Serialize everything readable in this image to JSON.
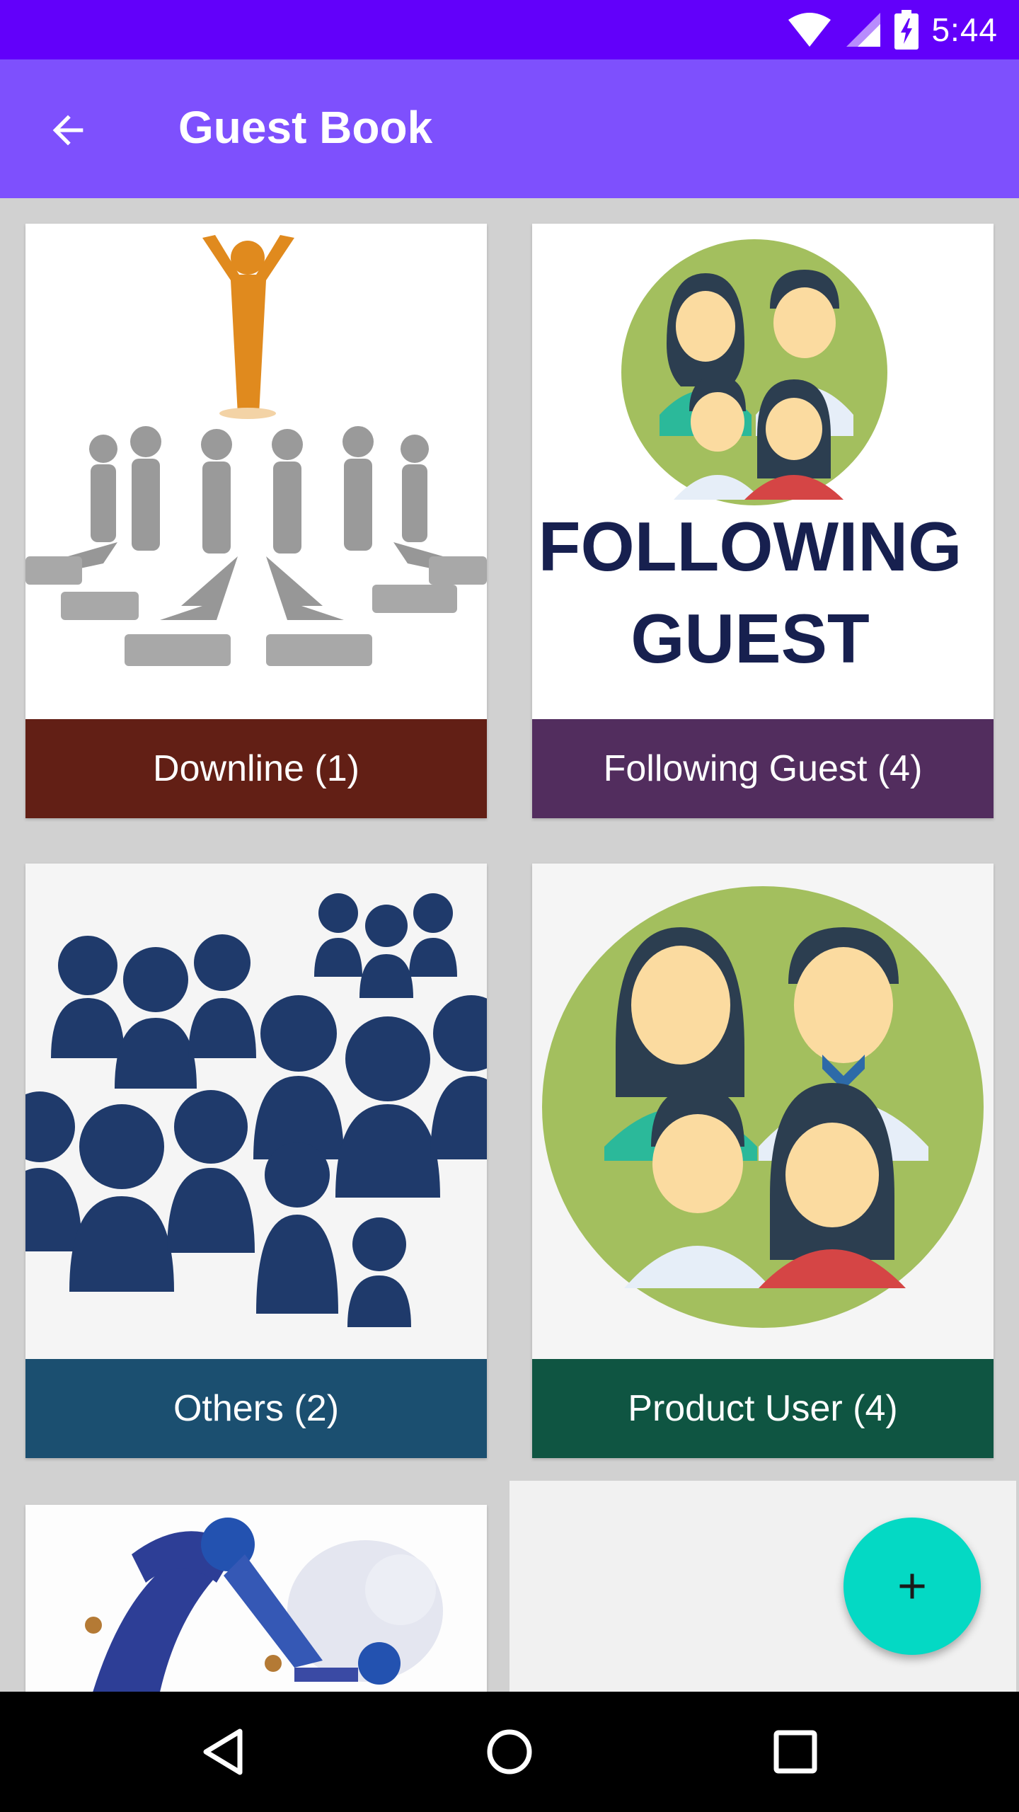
{
  "status_bar": {
    "time": "5:44",
    "icons": [
      "wifi-icon",
      "signal-icon",
      "battery-icon"
    ]
  },
  "app_bar": {
    "title": "Guest Book",
    "back_icon": "arrow-back-icon"
  },
  "cards": [
    {
      "label": "Downline (1)",
      "color": "#621f15"
    },
    {
      "label": "Following Guest (4)",
      "color": "#522d5e",
      "image_text_line1": "FOLLOWING",
      "image_text_line2": "GUEST"
    },
    {
      "label": "Others (2)",
      "color": "#1b4f70"
    },
    {
      "label": "Product User (4)",
      "color": "#0f5542"
    },
    {
      "label": ""
    }
  ],
  "fab": {
    "icon": "plus-icon",
    "color": "#04d9c4"
  },
  "nav_bar": {
    "icons": [
      "back-triangle-icon",
      "home-circle-icon",
      "recents-square-icon"
    ]
  }
}
